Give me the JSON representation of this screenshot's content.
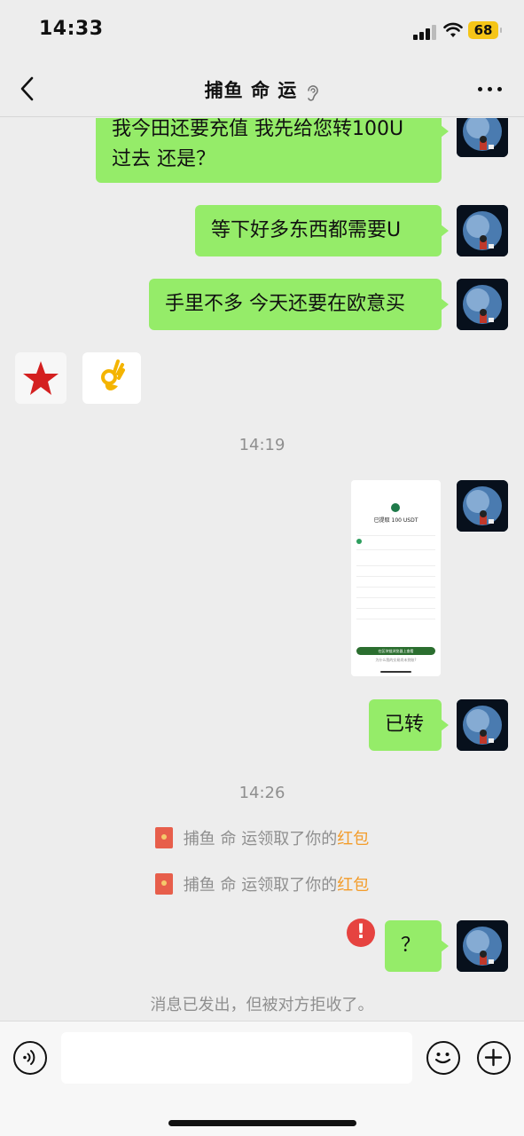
{
  "status_bar": {
    "time": "14:33",
    "battery": "68"
  },
  "header": {
    "title": "捕鱼 命 运",
    "icons": [
      "back-chevron-icon",
      "ear-icon",
      "more-icon"
    ]
  },
  "messages": {
    "m1": "我今田还要充值 我先给您转100U",
    "m1b": "过去 还是？",
    "m2": "等下好多东西都需要U",
    "m3": "手里不多 今天还要在欧意买",
    "m4": "已转",
    "m5": "？"
  },
  "timestamps": {
    "t1": "14:19",
    "t2": "14:26"
  },
  "system": {
    "rp1_prefix": "捕鱼  命  运领取了你的",
    "rp1_link": "红包",
    "rp2_prefix": "捕鱼  命  运领取了你的",
    "rp2_link": "红包",
    "rejected": "消息已发出，但被对方拒收了。"
  },
  "screenshot": {
    "headline": "已提取 100 USDT",
    "button": "在区块链浏览器上查看",
    "link": "为什么我的交易尚未到账?"
  },
  "error_mark": "!",
  "colors": {
    "bubble_self": "#95ec69",
    "background": "#ededed",
    "red_packet_link": "#f39c2a",
    "error": "#e64340"
  }
}
